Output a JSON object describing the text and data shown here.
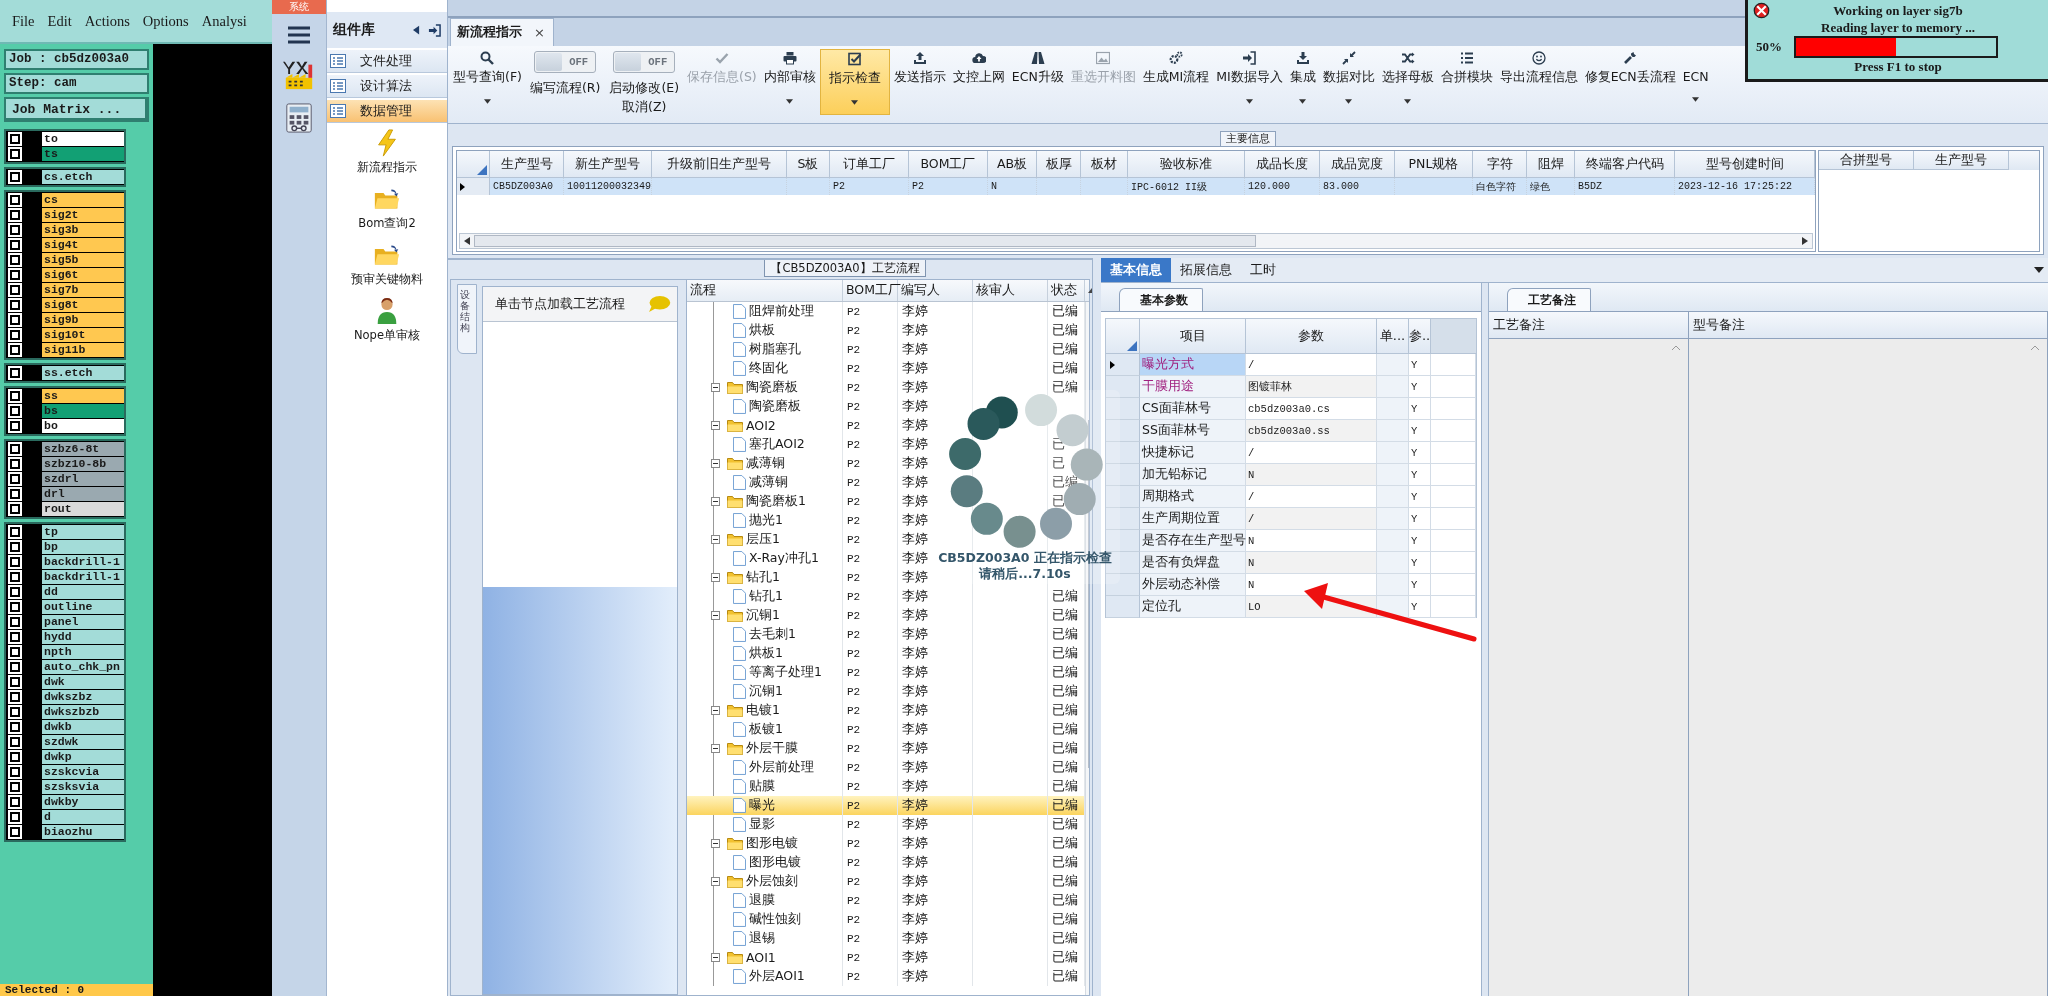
{
  "cam": {
    "menu": [
      "File",
      "Edit",
      "Actions",
      "Options",
      "Analysi"
    ],
    "job": "Job : cb5dz003a0",
    "step": "Step: cam",
    "matrix_button": "Job Matrix ...",
    "layer_groups": [
      [
        {
          "name": "to",
          "color": "#ffffff",
          "checked": false
        },
        {
          "name": "ts",
          "color": "#12a074",
          "checked": false
        }
      ],
      [
        {
          "name": "cs.etch",
          "color": "#a3dcd8",
          "checked": false
        }
      ],
      [
        {
          "name": "cs",
          "color": "#ffc850",
          "checked": false
        },
        {
          "name": "sig2t",
          "color": "#ffc850",
          "checked": false
        },
        {
          "name": "sig3b",
          "color": "#ffc850",
          "checked": false
        },
        {
          "name": "sig4t",
          "color": "#ffc850",
          "checked": false
        },
        {
          "name": "sig5b",
          "color": "#ffc850",
          "checked": false
        },
        {
          "name": "sig6t",
          "color": "#ffc850",
          "checked": false
        },
        {
          "name": "sig7b",
          "color": "#ffc850",
          "checked": false
        },
        {
          "name": "sig8t",
          "color": "#ffc850",
          "checked": false
        },
        {
          "name": "sig9b",
          "color": "#ffc850",
          "checked": false
        },
        {
          "name": "sig10t",
          "color": "#ffc850",
          "checked": false
        },
        {
          "name": "sig11b",
          "color": "#ffc850",
          "checked": false
        }
      ],
      [
        {
          "name": "ss.etch",
          "color": "#a3dcd8",
          "checked": false
        }
      ],
      [
        {
          "name": "ss",
          "color": "#ffc850",
          "checked": false
        },
        {
          "name": "bs",
          "color": "#12a074",
          "checked": false
        },
        {
          "name": "bo",
          "color": "#ffffff",
          "checked": false
        }
      ],
      [
        {
          "name": "szbz6-8t",
          "color": "#9aa9b0",
          "checked": false
        },
        {
          "name": "szbz10-8b",
          "color": "#9aa9b0",
          "checked": false
        },
        {
          "name": "szdrl",
          "color": "#9aa9b0",
          "checked": false
        },
        {
          "name": "drl",
          "color": "#9aa9b0",
          "checked": false
        },
        {
          "name": "rout",
          "color": "#dadada",
          "checked": false
        }
      ],
      [
        {
          "name": "tp",
          "color": "#a3dcd8",
          "checked": false
        },
        {
          "name": "bp",
          "color": "#a3dcd8",
          "checked": false
        },
        {
          "name": "backdrill-1",
          "color": "#a3dcd8",
          "checked": false
        },
        {
          "name": "backdrill-1",
          "color": "#a3dcd8",
          "checked": false
        },
        {
          "name": "dd",
          "color": "#a3dcd8",
          "checked": false
        },
        {
          "name": "outline",
          "color": "#a3dcd8",
          "checked": false
        },
        {
          "name": "panel",
          "color": "#a3dcd8",
          "checked": false
        },
        {
          "name": "hydd",
          "color": "#a3dcd8",
          "checked": false
        },
        {
          "name": "npth",
          "color": "#a3dcd8",
          "checked": false
        },
        {
          "name": "auto_chk_pn",
          "color": "#a3dcd8",
          "checked": false
        },
        {
          "name": "dwk",
          "color": "#a3dcd8",
          "checked": false
        },
        {
          "name": "dwkszbz",
          "color": "#a3dcd8",
          "checked": false
        },
        {
          "name": "dwkszbzb",
          "color": "#a3dcd8",
          "checked": false
        },
        {
          "name": "dwkb",
          "color": "#a3dcd8",
          "checked": false
        },
        {
          "name": "szdwk",
          "color": "#a3dcd8",
          "checked": false
        },
        {
          "name": "dwkp",
          "color": "#a3dcd8",
          "checked": false
        },
        {
          "name": "szskcvia",
          "color": "#a3dcd8",
          "checked": false
        },
        {
          "name": "szsksvia",
          "color": "#a3dcd8",
          "checked": false
        },
        {
          "name": "dwkby",
          "color": "#a3dcd8",
          "checked": false
        },
        {
          "name": "d",
          "color": "#a3dcd8",
          "checked": false
        },
        {
          "name": "biaozhu",
          "color": "#a3dcd8",
          "checked": false
        }
      ]
    ],
    "selected_count": "Selected : 0"
  },
  "app": {
    "system_tab": "系统",
    "component_panel": {
      "title": "组件库",
      "categories": [
        {
          "label": "文件处理",
          "selected": false
        },
        {
          "label": "设计算法",
          "selected": false
        },
        {
          "label": "数据管理",
          "selected": true
        }
      ],
      "items": [
        {
          "label": "新流程指示"
        },
        {
          "label": "Bom查询2"
        },
        {
          "label": "预审关键物料"
        },
        {
          "label": "Nope单审核"
        }
      ]
    }
  },
  "tabs": [
    {
      "label": "新流程指示",
      "close": "×",
      "selected": true
    }
  ],
  "toolbar": [
    {
      "kind": "button",
      "label": "型号查询(F)",
      "dropdown": true,
      "disabled": false,
      "highlighted": false
    },
    {
      "kind": "toggle",
      "state_text": "OFF",
      "on": false,
      "label": "编写流程(R)"
    },
    {
      "kind": "toggle",
      "state_text": "OFF",
      "on": false,
      "label": "启动修改(E)",
      "sublabel": "取消(Z)"
    },
    {
      "kind": "button",
      "label": "保存信息(S)",
      "dropdown": false,
      "disabled": true,
      "highlighted": false
    },
    {
      "kind": "button",
      "label": "内部审核",
      "dropdown": true,
      "disabled": false,
      "highlighted": false
    },
    {
      "kind": "button",
      "label": "指示检查",
      "dropdown": true,
      "disabled": false,
      "highlighted": true
    },
    {
      "kind": "button",
      "label": "发送指示",
      "dropdown": false,
      "disabled": false,
      "highlighted": false
    },
    {
      "kind": "button",
      "label": "文控上网",
      "dropdown": false,
      "disabled": false,
      "highlighted": false
    },
    {
      "kind": "button",
      "label": "ECN升级",
      "dropdown": false,
      "disabled": false,
      "highlighted": false
    },
    {
      "kind": "button",
      "label": "重选开料图",
      "dropdown": false,
      "disabled": true,
      "highlighted": false
    },
    {
      "kind": "button",
      "label": "生成MI流程",
      "dropdown": false,
      "disabled": false,
      "highlighted": false
    },
    {
      "kind": "button",
      "label": "MI数据导入",
      "dropdown": true,
      "disabled": false,
      "highlighted": false
    },
    {
      "kind": "button",
      "label": "集成",
      "dropdown": true,
      "disabled": false,
      "highlighted": false
    },
    {
      "kind": "button",
      "label": "数据对比",
      "dropdown": true,
      "disabled": false,
      "highlighted": false
    },
    {
      "kind": "button",
      "label": "选择母板",
      "dropdown": true,
      "disabled": false,
      "highlighted": false
    },
    {
      "kind": "button",
      "label": "合拼模块",
      "dropdown": false,
      "disabled": false,
      "highlighted": false
    },
    {
      "kind": "button",
      "label": "导出流程信息",
      "dropdown": false,
      "disabled": false,
      "highlighted": false
    },
    {
      "kind": "button",
      "label": "修复ECN丢流程",
      "dropdown": false,
      "disabled": false,
      "highlighted": false
    },
    {
      "kind": "button",
      "label": "ECN",
      "dropdown": true,
      "disabled": false,
      "highlighted": false
    }
  ],
  "main_info": {
    "title": "主要信息",
    "columns": [
      "生产型号",
      "新生产型号",
      "升级前旧生产型号",
      "S板",
      "订单工厂",
      "BOM工厂",
      "AB板",
      "板厚",
      "板材",
      "验收标准",
      "成品长度",
      "成品宽度",
      "PNL规格",
      "字符",
      "阻焊",
      "终端客户代码",
      "型号创建时间"
    ],
    "rows": [
      {
        "selected": true,
        "cells": [
          "CB5DZ003A0",
          "10011200032349",
          null,
          null,
          "P2",
          "P2",
          "N",
          null,
          null,
          "IPC-6012 II级",
          "120.000",
          "83.000",
          null,
          "白色字符",
          "绿色",
          "B5DZ",
          "2023-12-16 17:25:22"
        ]
      }
    ],
    "merge_table": {
      "columns": [
        "合拼型号",
        "生产型号"
      ]
    }
  },
  "process": {
    "title": "【CB5DZ003A0】工艺流程",
    "side_tab": "设备结构",
    "hint": "单击节点加载工艺流程",
    "columns": [
      "流程",
      "BOM工厂",
      "编写人",
      "核审人",
      "状态"
    ],
    "tree": [
      {
        "kind": "step",
        "name": "阻焊前处理",
        "bom": "P2",
        "writer": "李婷",
        "status": "已编",
        "selected": false
      },
      {
        "kind": "step",
        "name": "烘板",
        "bom": "P2",
        "writer": "李婷",
        "status": "已编",
        "selected": false
      },
      {
        "kind": "step",
        "name": "树脂塞孔",
        "bom": "P2",
        "writer": "李婷",
        "status": "已编",
        "selected": false
      },
      {
        "kind": "step",
        "name": "终固化",
        "bom": "P2",
        "writer": "李婷",
        "status": "已编",
        "selected": false
      },
      {
        "kind": "group",
        "name": "陶瓷磨板",
        "bom": "P2",
        "writer": "李婷",
        "status": "已编",
        "selected": false,
        "expanded": true,
        "children": [
          {
            "kind": "step",
            "name": "陶瓷磨板",
            "bom": "P2",
            "writer": "李婷",
            "selected": false
          }
        ]
      },
      {
        "kind": "group",
        "name": "AOI2",
        "bom": "P2",
        "writer": "李婷",
        "selected": false,
        "expanded": true,
        "children": [
          {
            "kind": "step",
            "name": "塞孔AOI2",
            "bom": "P2",
            "writer": "李婷",
            "status": "已",
            "selected": false
          }
        ]
      },
      {
        "kind": "group",
        "name": "减薄铜",
        "bom": "P2",
        "writer": "李婷",
        "status": "已",
        "selected": false,
        "expanded": true,
        "children": [
          {
            "kind": "step",
            "name": "减薄铜",
            "bom": "P2",
            "writer": "李婷",
            "status": "已编",
            "selected": false
          }
        ]
      },
      {
        "kind": "group",
        "name": "陶瓷磨板1",
        "bom": "P2",
        "writer": "李婷",
        "status": "已",
        "selected": false,
        "expanded": true,
        "children": [
          {
            "kind": "step",
            "name": "抛光1",
            "bom": "P2",
            "writer": "李婷",
            "selected": false
          }
        ]
      },
      {
        "kind": "group",
        "name": "层压1",
        "bom": "P2",
        "writer": "李婷",
        "selected": false,
        "expanded": true,
        "children": [
          {
            "kind": "step",
            "name": "X-Ray冲孔1",
            "bom": "P2",
            "writer": "李婷",
            "selected": false
          }
        ]
      },
      {
        "kind": "group",
        "name": "钻孔1",
        "bom": "P2",
        "writer": "李婷",
        "selected": false,
        "expanded": true,
        "children": [
          {
            "kind": "step",
            "name": "钻孔1",
            "bom": "P2",
            "writer": "李婷",
            "status": "已编",
            "selected": false
          }
        ]
      },
      {
        "kind": "group",
        "name": "沉铜1",
        "bom": "P2",
        "writer": "李婷",
        "status": "已编",
        "selected": false,
        "expanded": true,
        "children": [
          {
            "kind": "step",
            "name": "去毛刺1",
            "bom": "P2",
            "writer": "李婷",
            "status": "已编",
            "selected": false
          },
          {
            "kind": "step",
            "name": "烘板1",
            "bom": "P2",
            "writer": "李婷",
            "status": "已编",
            "selected": false
          },
          {
            "kind": "step",
            "name": "等离子处理1",
            "bom": "P2",
            "writer": "李婷",
            "status": "已编",
            "selected": false
          },
          {
            "kind": "step",
            "name": "沉铜1",
            "bom": "P2",
            "writer": "李婷",
            "status": "已编",
            "selected": false
          }
        ]
      },
      {
        "kind": "group",
        "name": "电镀1",
        "bom": "P2",
        "writer": "李婷",
        "status": "已编",
        "selected": false,
        "expanded": true,
        "children": [
          {
            "kind": "step",
            "name": "板镀1",
            "bom": "P2",
            "writer": "李婷",
            "status": "已编",
            "selected": false
          }
        ]
      },
      {
        "kind": "group",
        "name": "外层干膜",
        "bom": "P2",
        "writer": "李婷",
        "status": "已编",
        "selected": false,
        "expanded": true,
        "children": [
          {
            "kind": "step",
            "name": "外层前处理",
            "bom": "P2",
            "writer": "李婷",
            "status": "已编",
            "selected": false
          },
          {
            "kind": "step",
            "name": "贴膜",
            "bom": "P2",
            "writer": "李婷",
            "status": "已编",
            "selected": false
          },
          {
            "kind": "step",
            "name": "曝光",
            "bom": "P2",
            "writer": "李婷",
            "status": "已编",
            "selected": true
          },
          {
            "kind": "step",
            "name": "显影",
            "bom": "P2",
            "writer": "李婷",
            "status": "已编",
            "selected": false
          }
        ]
      },
      {
        "kind": "group",
        "name": "图形电镀",
        "bom": "P2",
        "writer": "李婷",
        "status": "已编",
        "selected": false,
        "expanded": true,
        "children": [
          {
            "kind": "step",
            "name": "图形电镀",
            "bom": "P2",
            "writer": "李婷",
            "status": "已编",
            "selected": false
          }
        ]
      },
      {
        "kind": "group",
        "name": "外层蚀刻",
        "bom": "P2",
        "writer": "李婷",
        "status": "已编",
        "selected": false,
        "expanded": true,
        "children": [
          {
            "kind": "step",
            "name": "退膜",
            "bom": "P2",
            "writer": "李婷",
            "status": "已编",
            "selected": false
          },
          {
            "kind": "step",
            "name": "碱性蚀刻",
            "bom": "P2",
            "writer": "李婷",
            "status": "已编",
            "selected": false
          },
          {
            "kind": "step",
            "name": "退锡",
            "bom": "P2",
            "writer": "李婷",
            "status": "已编",
            "selected": false
          }
        ]
      },
      {
        "kind": "group",
        "name": "AOI1",
        "bom": "P2",
        "writer": "李婷",
        "status": "已编",
        "selected": false,
        "expanded": true,
        "children": [
          {
            "kind": "step",
            "name": "外层AOI1",
            "bom": "P2",
            "writer": "李婷",
            "status": "已编",
            "selected": false
          }
        ]
      }
    ]
  },
  "loading": {
    "lines": [
      "CB5DZ003A0 正在指示检查",
      "请稍后...7.10s"
    ]
  },
  "detail": {
    "tabs": [
      {
        "label": "基本信息",
        "selected": true
      },
      {
        "label": "拓展信息",
        "selected": false
      },
      {
        "label": "工时",
        "selected": false
      }
    ],
    "params": {
      "tab": "基本参数",
      "columns": [
        "项目",
        "参数",
        "单...",
        "参.."
      ],
      "rows": [
        {
          "item": "曝光方式",
          "value": "/",
          "flag": "Y",
          "highlighted": true,
          "selected": true
        },
        {
          "item": "干膜用途",
          "value": "图镀菲林",
          "flag": "Y",
          "highlighted": true,
          "selected": false
        },
        {
          "item": "CS面菲林号",
          "value": "cb5dz003a0.cs",
          "flag": "Y",
          "highlighted": false,
          "selected": false
        },
        {
          "item": "SS面菲林号",
          "value": "cb5dz003a0.ss",
          "flag": "Y",
          "highlighted": false,
          "selected": false
        },
        {
          "item": "快捷标记",
          "value": "/",
          "flag": "Y",
          "highlighted": false,
          "selected": false
        },
        {
          "item": "加无铅标记",
          "value": "N",
          "flag": "Y",
          "highlighted": false,
          "selected": false
        },
        {
          "item": "周期格式",
          "value": "/",
          "flag": "Y",
          "highlighted": false,
          "selected": false
        },
        {
          "item": "生产周期位置",
          "value": "/",
          "flag": "Y",
          "highlighted": false,
          "selected": false
        },
        {
          "item": "是否存在生产型号",
          "value": "N",
          "flag": "Y",
          "highlighted": false,
          "selected": false
        },
        {
          "item": "是否有负焊盘",
          "value": "N",
          "flag": "Y",
          "highlighted": false,
          "selected": false
        },
        {
          "item": "外层动态补偿",
          "value": "N",
          "flag": "Y",
          "highlighted": false,
          "selected": false
        },
        {
          "item": "定位孔",
          "value": "LO",
          "flag": "Y",
          "highlighted": false,
          "selected": false
        }
      ]
    },
    "notes": {
      "tab": "工艺备注",
      "columns": [
        "工艺备注",
        "型号备注"
      ]
    }
  },
  "progress": {
    "title": "Working on layer sig7b",
    "message": "Reading layer to memory ...",
    "percent": "50%",
    "level": 0.5,
    "hint": "Press F1 to stop"
  }
}
